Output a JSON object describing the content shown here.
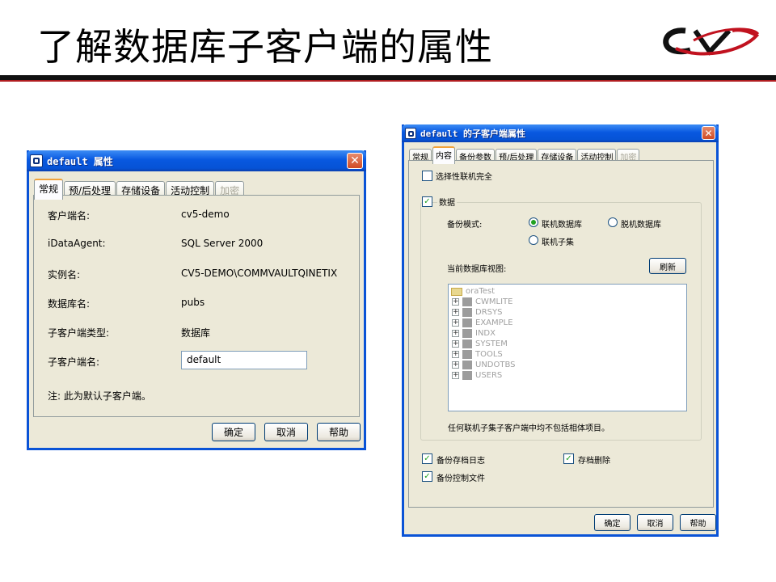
{
  "slide": {
    "title": "了解数据库子客户端的属性"
  },
  "colors": {
    "xp_blue": "#0858e0",
    "close_red": "#d04a24",
    "dialog_bg": "#ece9d8",
    "check_green": "#21a121",
    "logo_red": "#c1121f"
  },
  "dialog1": {
    "title": "default 属性",
    "tabs": [
      {
        "label": "常规",
        "active": true
      },
      {
        "label": "预/后处理"
      },
      {
        "label": "存储设备"
      },
      {
        "label": "活动控制"
      },
      {
        "label": "加密",
        "disabled": true
      }
    ],
    "fields": [
      {
        "label": "客户端名:",
        "value": "cv5-demo"
      },
      {
        "label": "iDataAgent:",
        "value": "SQL Server 2000"
      },
      {
        "label": "实例名:",
        "value": "CV5-DEMO\\COMMVAULTQINETIX"
      },
      {
        "label": "数据库名:",
        "value": "pubs"
      },
      {
        "label": "子客户端类型:",
        "value": "数据库"
      },
      {
        "label": "子客户端名:",
        "value": "default"
      }
    ],
    "note": "注: 此为默认子客户端。",
    "buttons": {
      "ok": "确定",
      "cancel": "取消",
      "help": "帮助"
    }
  },
  "dialog2": {
    "title": "default 的子客户端属性",
    "tabs": [
      {
        "label": "常规"
      },
      {
        "label": "内容",
        "active": true
      },
      {
        "label": "备份参数"
      },
      {
        "label": "预/后处理"
      },
      {
        "label": "存储设备"
      },
      {
        "label": "活动控制"
      },
      {
        "label": "加密",
        "disabled": true
      }
    ],
    "selective_online_full": "选择性联机完全",
    "data_group": "数据",
    "backup_mode_label": "备份模式:",
    "modes": {
      "online_db": "联机数据库",
      "offline_db": "脱机数据库",
      "online_subset": "联机子集"
    },
    "current_view_label": "当前数据库视图:",
    "refresh": "刷新",
    "tree": {
      "root": "oraTest",
      "items": [
        "CWMLITE",
        "DRSYS",
        "EXAMPLE",
        "INDX",
        "SYSTEM",
        "TOOLS",
        "UNDOTBS",
        "USERS"
      ]
    },
    "subset_note": "任何联机子集子客户端中均不包括相体项目。",
    "backup_archive_log": "备份存档日志",
    "archive_delete": "存档删除",
    "backup_control_file": "备份控制文件",
    "buttons": {
      "ok": "确定",
      "cancel": "取消",
      "help": "帮助"
    }
  }
}
